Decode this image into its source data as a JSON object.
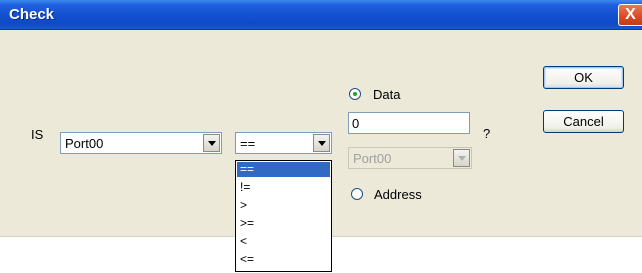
{
  "window": {
    "title": "Check",
    "close_label": "X"
  },
  "condition": {
    "is_label": "IS",
    "port_combo": {
      "value": "Port00"
    },
    "operator_combo": {
      "value": "=="
    },
    "operator_options": [
      "==",
      "!=",
      ">",
      ">=",
      "<",
      "<="
    ],
    "selected_operator_index": 0
  },
  "target": {
    "data_radio_label": "Data",
    "data_radio_checked": true,
    "data_value": "0",
    "question_mark": "?",
    "address_combo": {
      "value": "Port00",
      "disabled": true
    },
    "address_radio_label": "Address",
    "address_radio_checked": false
  },
  "buttons": {
    "ok_label": "OK",
    "cancel_label": "Cancel"
  },
  "colors": {
    "titlebar": "#1452d2",
    "dialog_bg": "#ece9d8",
    "selection": "#316ac5",
    "close_button": "#d84a23"
  }
}
